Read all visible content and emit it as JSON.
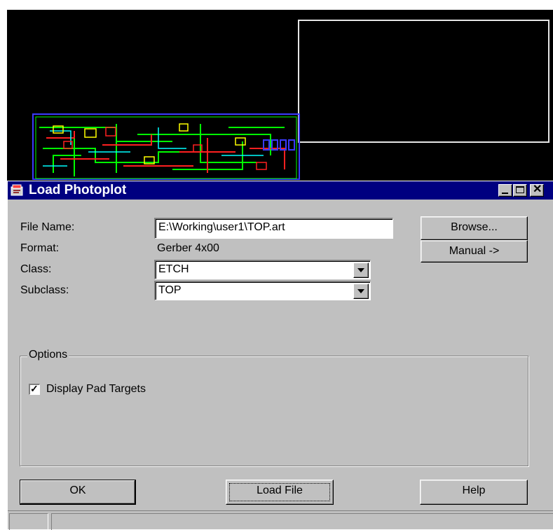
{
  "dialog": {
    "title": "Load Photoplot",
    "title_icon": "photoplot-app-icon",
    "window_controls": [
      "minimize-icon",
      "maximize-icon",
      "close-icon"
    ]
  },
  "form": {
    "file_name_label": "File Name:",
    "file_name_value": "E:\\Working\\user1\\TOP.art",
    "format_label": "Format:",
    "format_value": "Gerber 4x00",
    "class_label": "Class:",
    "class_value": "ETCH",
    "subclass_label": "Subclass:",
    "subclass_value": "TOP"
  },
  "buttons": {
    "browse": "Browse...",
    "manual": "Manual   ->",
    "ok": "OK",
    "load_file": "Load File",
    "help": "Help"
  },
  "options": {
    "group_label": "Options",
    "display_pad_targets_label": "Display Pad Targets",
    "display_pad_targets_checked": true
  },
  "colors": {
    "canvas_bg": "#000000",
    "title_bar": "#000080",
    "dialog_bg": "#c0c0c0",
    "pcb_outline": "#3a3aff",
    "pcb_trace_green": "#00ff00",
    "pcb_trace_red": "#ff2020",
    "pcb_trace_cyan": "#00ffff",
    "pcb_trace_yellow": "#ffff00"
  }
}
